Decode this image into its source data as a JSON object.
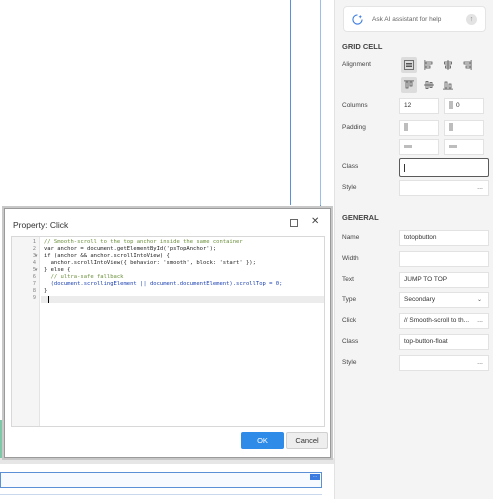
{
  "ai_assistant": {
    "placeholder": "Ask AI assistant for help"
  },
  "grid_cell": {
    "section_title": "GRID CELL",
    "alignment_label": "Alignment",
    "columns_label": "Columns",
    "columns_value": "12",
    "offset_value": "0",
    "padding_label": "Padding",
    "class_label": "Class",
    "class_value": "",
    "style_label": "Style",
    "style_button": "..."
  },
  "general": {
    "section_title": "GENERAL",
    "name_label": "Name",
    "name_value": "totopbutton",
    "width_label": "Width",
    "width_value": "",
    "text_label": "Text",
    "text_value": "JUMP TO TOP",
    "type_label": "Type",
    "type_value": "Secondary",
    "click_label": "Click",
    "click_value": "// Smooth-scroll to th...",
    "click_button": "...",
    "class_label": "Class",
    "class_value": "top-button-float",
    "style_label": "Style",
    "style_button": "..."
  },
  "dialog": {
    "title": "Property: Click",
    "ok_label": "OK",
    "cancel_label": "Cancel",
    "line_numbers": [
      "1",
      "2",
      "3",
      "4",
      "5",
      "6",
      "7",
      "8",
      "9"
    ],
    "code_lines": [
      "// Smooth-scroll to the top anchor inside the same container",
      "var anchor = document.getElementById('psTopAnchor');",
      "if (anchor && anchor.scrollIntoView) {",
      "  anchor.scrollIntoView({ behavior: 'smooth', block: 'start' });",
      "} else {",
      "  // ultra-safe fallback",
      "  (document.scrollingElement || document.documentElement).scrollTop = 0;",
      "}",
      ""
    ]
  },
  "colors": {
    "accent": "#2f8be8",
    "selection_blue": "#5b8fd6"
  }
}
